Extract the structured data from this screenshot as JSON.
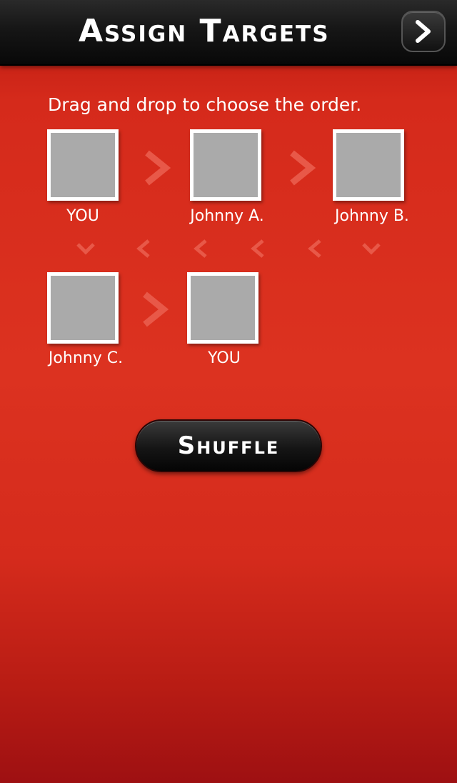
{
  "header": {
    "title": "Assign Targets",
    "next_icon": "chevron-right-icon"
  },
  "instruction": "Drag and drop to choose the order.",
  "targets": [
    {
      "label": "YOU"
    },
    {
      "label": "Johnny A."
    },
    {
      "label": "Johnny B."
    },
    {
      "label": "Johnny C."
    },
    {
      "label": "YOU"
    }
  ],
  "shuffle_label": "Shuffle",
  "colors": {
    "background_top": "#b61810",
    "background_mid": "#dc3220",
    "background_bottom": "#9e1012",
    "header": "#111111",
    "tile_fill": "#aaaaaa",
    "tile_border": "#ffffff",
    "arrow": "#e85848"
  }
}
